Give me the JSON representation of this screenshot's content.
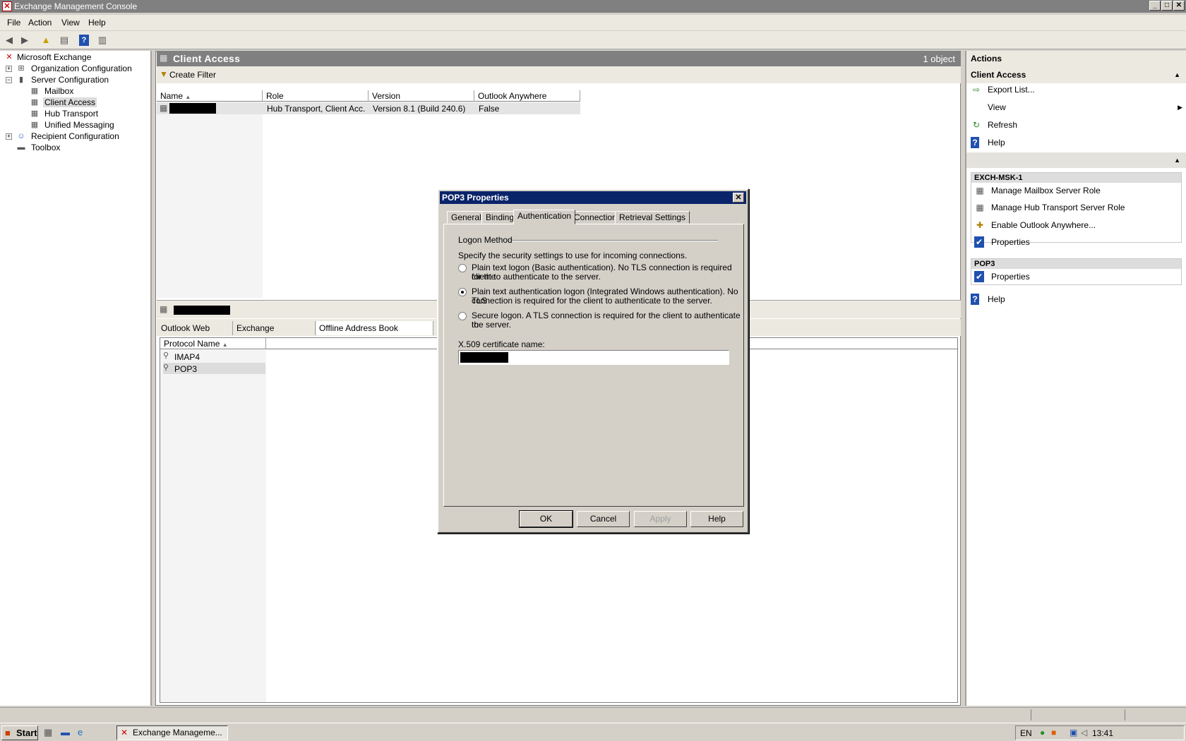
{
  "window": {
    "title": "Exchange Management Console",
    "min": "_",
    "max": "□",
    "close": "✕"
  },
  "menu": [
    "File",
    "Action",
    "View",
    "Help"
  ],
  "tree": {
    "root": "Microsoft Exchange",
    "org": "Organization Configuration",
    "server": "Server Configuration",
    "mailbox": "Mailbox",
    "client_access": "Client Access",
    "hub": "Hub Transport",
    "um": "Unified Messaging",
    "recipient": "Recipient Configuration",
    "toolbox": "Toolbox"
  },
  "center": {
    "title": "Client Access",
    "count": "1 object",
    "create_filter": "Create Filter",
    "columns": [
      "Name",
      "Role",
      "Version",
      "Outlook Anywhere Enabled"
    ],
    "row": {
      "role": "Hub Transport, Client Acc...",
      "version": "Version 8.1 (Build 240.6)",
      "oa": "False"
    },
    "bottom_tabs": [
      "Outlook Web Access",
      "Exchange ActiveSync",
      "Offline Address Book Distribution"
    ],
    "protocol_header": "Protocol Name",
    "protocols": [
      "IMAP4",
      "POP3"
    ]
  },
  "dialog": {
    "title": "POP3 Properties",
    "tabs": [
      "General",
      "Binding",
      "Authentication",
      "Connection",
      "Retrieval Settings"
    ],
    "group": "Logon Method",
    "intro": "Specify the security settings to use for incoming connections.",
    "opt1_l1": "Plain text logon (Basic authentication). No TLS connection is required for the",
    "opt1_l2": "client to authenticate to the server.",
    "opt2_l1": "Plain text authentication logon (Integrated Windows authentication). No TLS",
    "opt2_l2": "connection is required for the client to authenticate to the server.",
    "opt3_l1": "Secure logon. A TLS connection is required for the client to authenticate to",
    "opt3_l2": "the server.",
    "cert_label": "X.509 certificate name:",
    "buttons": {
      "ok": "OK",
      "cancel": "Cancel",
      "apply": "Apply",
      "help": "Help"
    },
    "close": "✕"
  },
  "actions": {
    "header": "Actions",
    "section1": "Client Access",
    "export": "Export List...",
    "view": "View",
    "refresh": "Refresh",
    "help": "Help",
    "server_group": "EXCH-MSK-1",
    "manage_mbx": "Manage Mailbox Server Role",
    "manage_hub": "Manage Hub Transport Server Role",
    "enable_oa": "Enable Outlook Anywhere...",
    "properties": "Properties",
    "pop3_group": "POP3",
    "pop3_properties": "Properties",
    "help2": "Help"
  },
  "taskbar": {
    "start": "Start",
    "task": "Exchange Manageme...",
    "lang": "EN",
    "time": "13:41"
  }
}
